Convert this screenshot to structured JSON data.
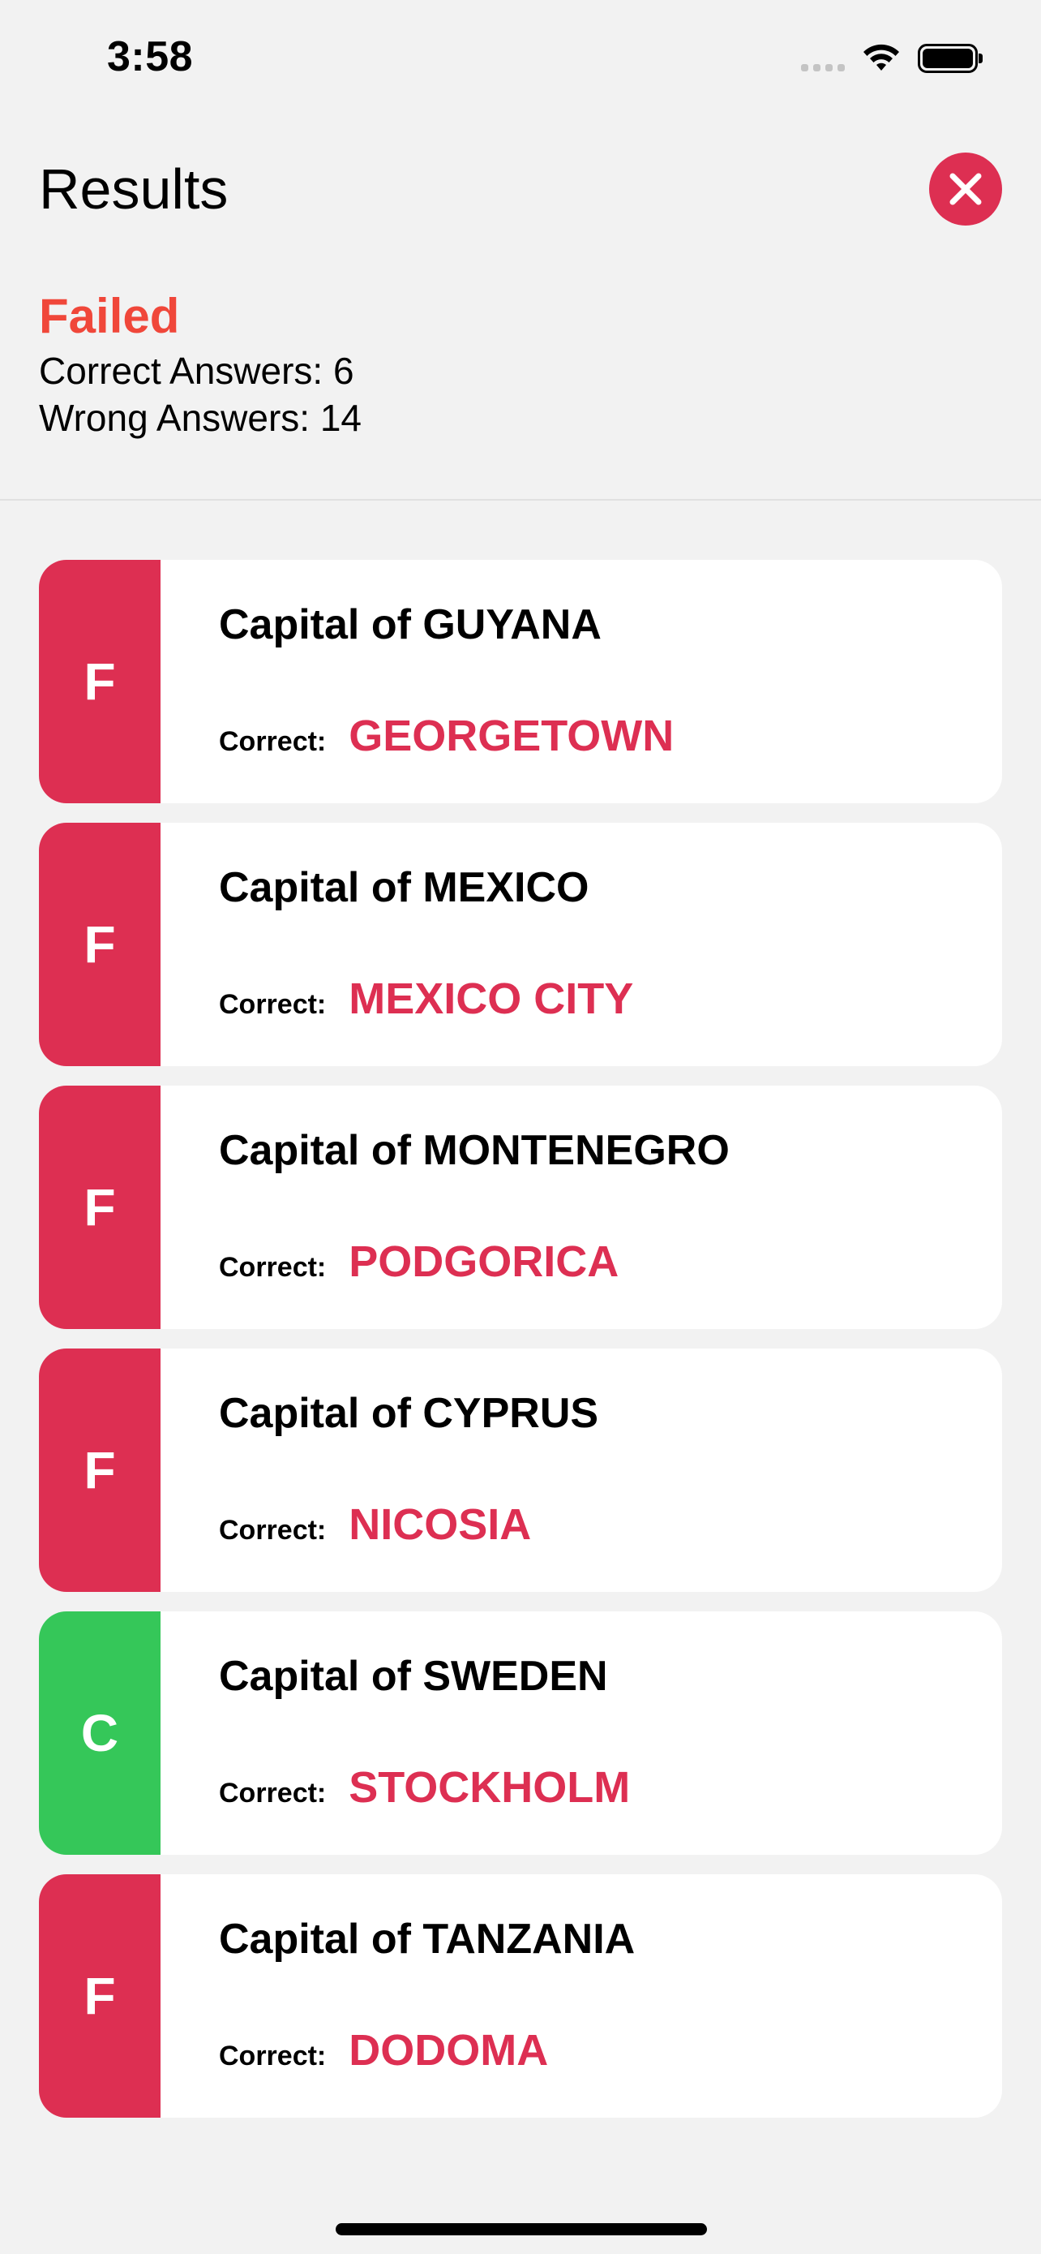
{
  "status_bar": {
    "time": "3:58"
  },
  "header": {
    "title": "Results",
    "close_icon": "close-icon",
    "accent_color": "#dd2f52"
  },
  "summary": {
    "status": "Failed",
    "status_color": "#f0473a",
    "correct_line": "Correct Answers: 6",
    "wrong_line": "Wrong Answers: 14"
  },
  "colors": {
    "fail": "#dd2f52",
    "correct": "#35c759",
    "answer_text": "#dd2f52"
  },
  "results": [
    {
      "grade": "F",
      "question": "Capital of GUYANA",
      "answer_label": "Correct:",
      "answer": "GEORGETOWN"
    },
    {
      "grade": "F",
      "question": "Capital of MEXICO",
      "answer_label": "Correct:",
      "answer": "MEXICO CITY"
    },
    {
      "grade": "F",
      "question": "Capital of MONTENEGRO",
      "answer_label": "Correct:",
      "answer": "PODGORICA"
    },
    {
      "grade": "F",
      "question": "Capital of CYPRUS",
      "answer_label": "Correct:",
      "answer": "NICOSIA"
    },
    {
      "grade": "C",
      "question": "Capital of SWEDEN",
      "answer_label": "Correct:",
      "answer": "STOCKHOLM"
    },
    {
      "grade": "F",
      "question": "Capital of TANZANIA",
      "answer_label": "Correct:",
      "answer": "DODOMA"
    }
  ]
}
